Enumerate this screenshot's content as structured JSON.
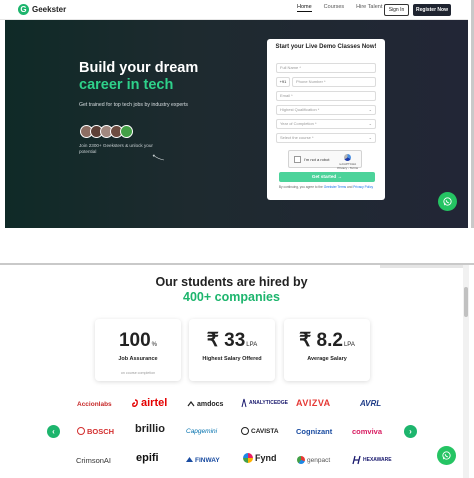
{
  "brand": {
    "name": "Geekster",
    "mark": "G",
    "color": "#1db56d"
  },
  "nav": {
    "links": [
      "Home",
      "Courses",
      "Hire Talent"
    ],
    "signin_label": "Sign In",
    "register_label": "Register Now"
  },
  "hero": {
    "title_line1": "Build your dream",
    "title_line2": "career in tech",
    "subtitle": "Get trained for top tech jobs by industry experts",
    "join_text": "Join 2300+ Geeksters & unlock your potential"
  },
  "form": {
    "title": "Start your Live Demo Classes Now!",
    "full_name_placeholder": "Full Name *",
    "phone_code": "+91",
    "phone_placeholder": "Phone Number *",
    "email_placeholder": "Email *",
    "qualification_placeholder": "Highest Qualification *",
    "completion_placeholder": "Year of Completion *",
    "course_placeholder": "Select the course *",
    "captcha_label": "I'm not a robot",
    "captcha_brand": "reCAPTCHA",
    "captcha_links": "Privacy - Terms",
    "submit_label": "Get started",
    "terms_prefix": "By continuing, you agree to the",
    "terms_link": "Geekster Terms",
    "terms_and": "and",
    "privacy_link": "Privacy Policy"
  },
  "hired": {
    "title": "Our students are hired by",
    "subtitle": "400+ companies"
  },
  "stats": [
    {
      "value": "100",
      "unit": "%",
      "label": "Job Assurance",
      "note": "on course completion"
    },
    {
      "value": "₹ 33",
      "unit": "LPA",
      "label": "Highest Salary Offered",
      "note": ""
    },
    {
      "value": "₹ 8.2",
      "unit": "LPA",
      "label": "Average Salary",
      "note": ""
    }
  ],
  "companies": [
    {
      "name": "Accionlabs",
      "color": "#c62828",
      "icon": "none"
    },
    {
      "name": "airtel",
      "color": "#e40000",
      "icon": "airtel-swirl-icon"
    },
    {
      "name": "amdocs",
      "color": "#222222",
      "icon": "amdocs-icon"
    },
    {
      "name": "ANALYTICEDGE",
      "color": "#1a1a6e",
      "icon": "analyticedge-icon"
    },
    {
      "name": "AVIZVA",
      "color": "#e53935",
      "icon": "none"
    },
    {
      "name": "AVRL",
      "color": "#1f3c88",
      "icon": "none"
    },
    {
      "name": "BOSCH",
      "color": "#d32f2f",
      "icon": "bosch-ring-icon"
    },
    {
      "name": "brillio",
      "color": "#222222",
      "icon": "none"
    },
    {
      "name": "Capgemini",
      "color": "#0070ad",
      "icon": "none"
    },
    {
      "name": "CAVISTA",
      "color": "#222222",
      "icon": "cavista-icon"
    },
    {
      "name": "Cognizant",
      "color": "#1a4ca1",
      "icon": "none"
    },
    {
      "name": "comviva",
      "color": "#d81b60",
      "icon": "none"
    },
    {
      "name": "CrimsonAI",
      "color": "#333333",
      "icon": "none"
    },
    {
      "name": "epifi",
      "color": "#111111",
      "icon": "none"
    },
    {
      "name": "FINWAY",
      "color": "#1a4ca1",
      "icon": "finway-icon"
    },
    {
      "name": "Fynd",
      "color": "#222222",
      "icon": "fynd-icon"
    },
    {
      "name": "genpact",
      "color": "#555555",
      "icon": "genpact-icon"
    },
    {
      "name": "HEXAWARE",
      "color": "#1a1a6e",
      "icon": "hexaware-icon"
    }
  ],
  "colors": {
    "accent": "#1db56d",
    "whatsapp": "#25c463",
    "hero_bg": "#1e2a2f",
    "cta": "#4cd39a"
  }
}
